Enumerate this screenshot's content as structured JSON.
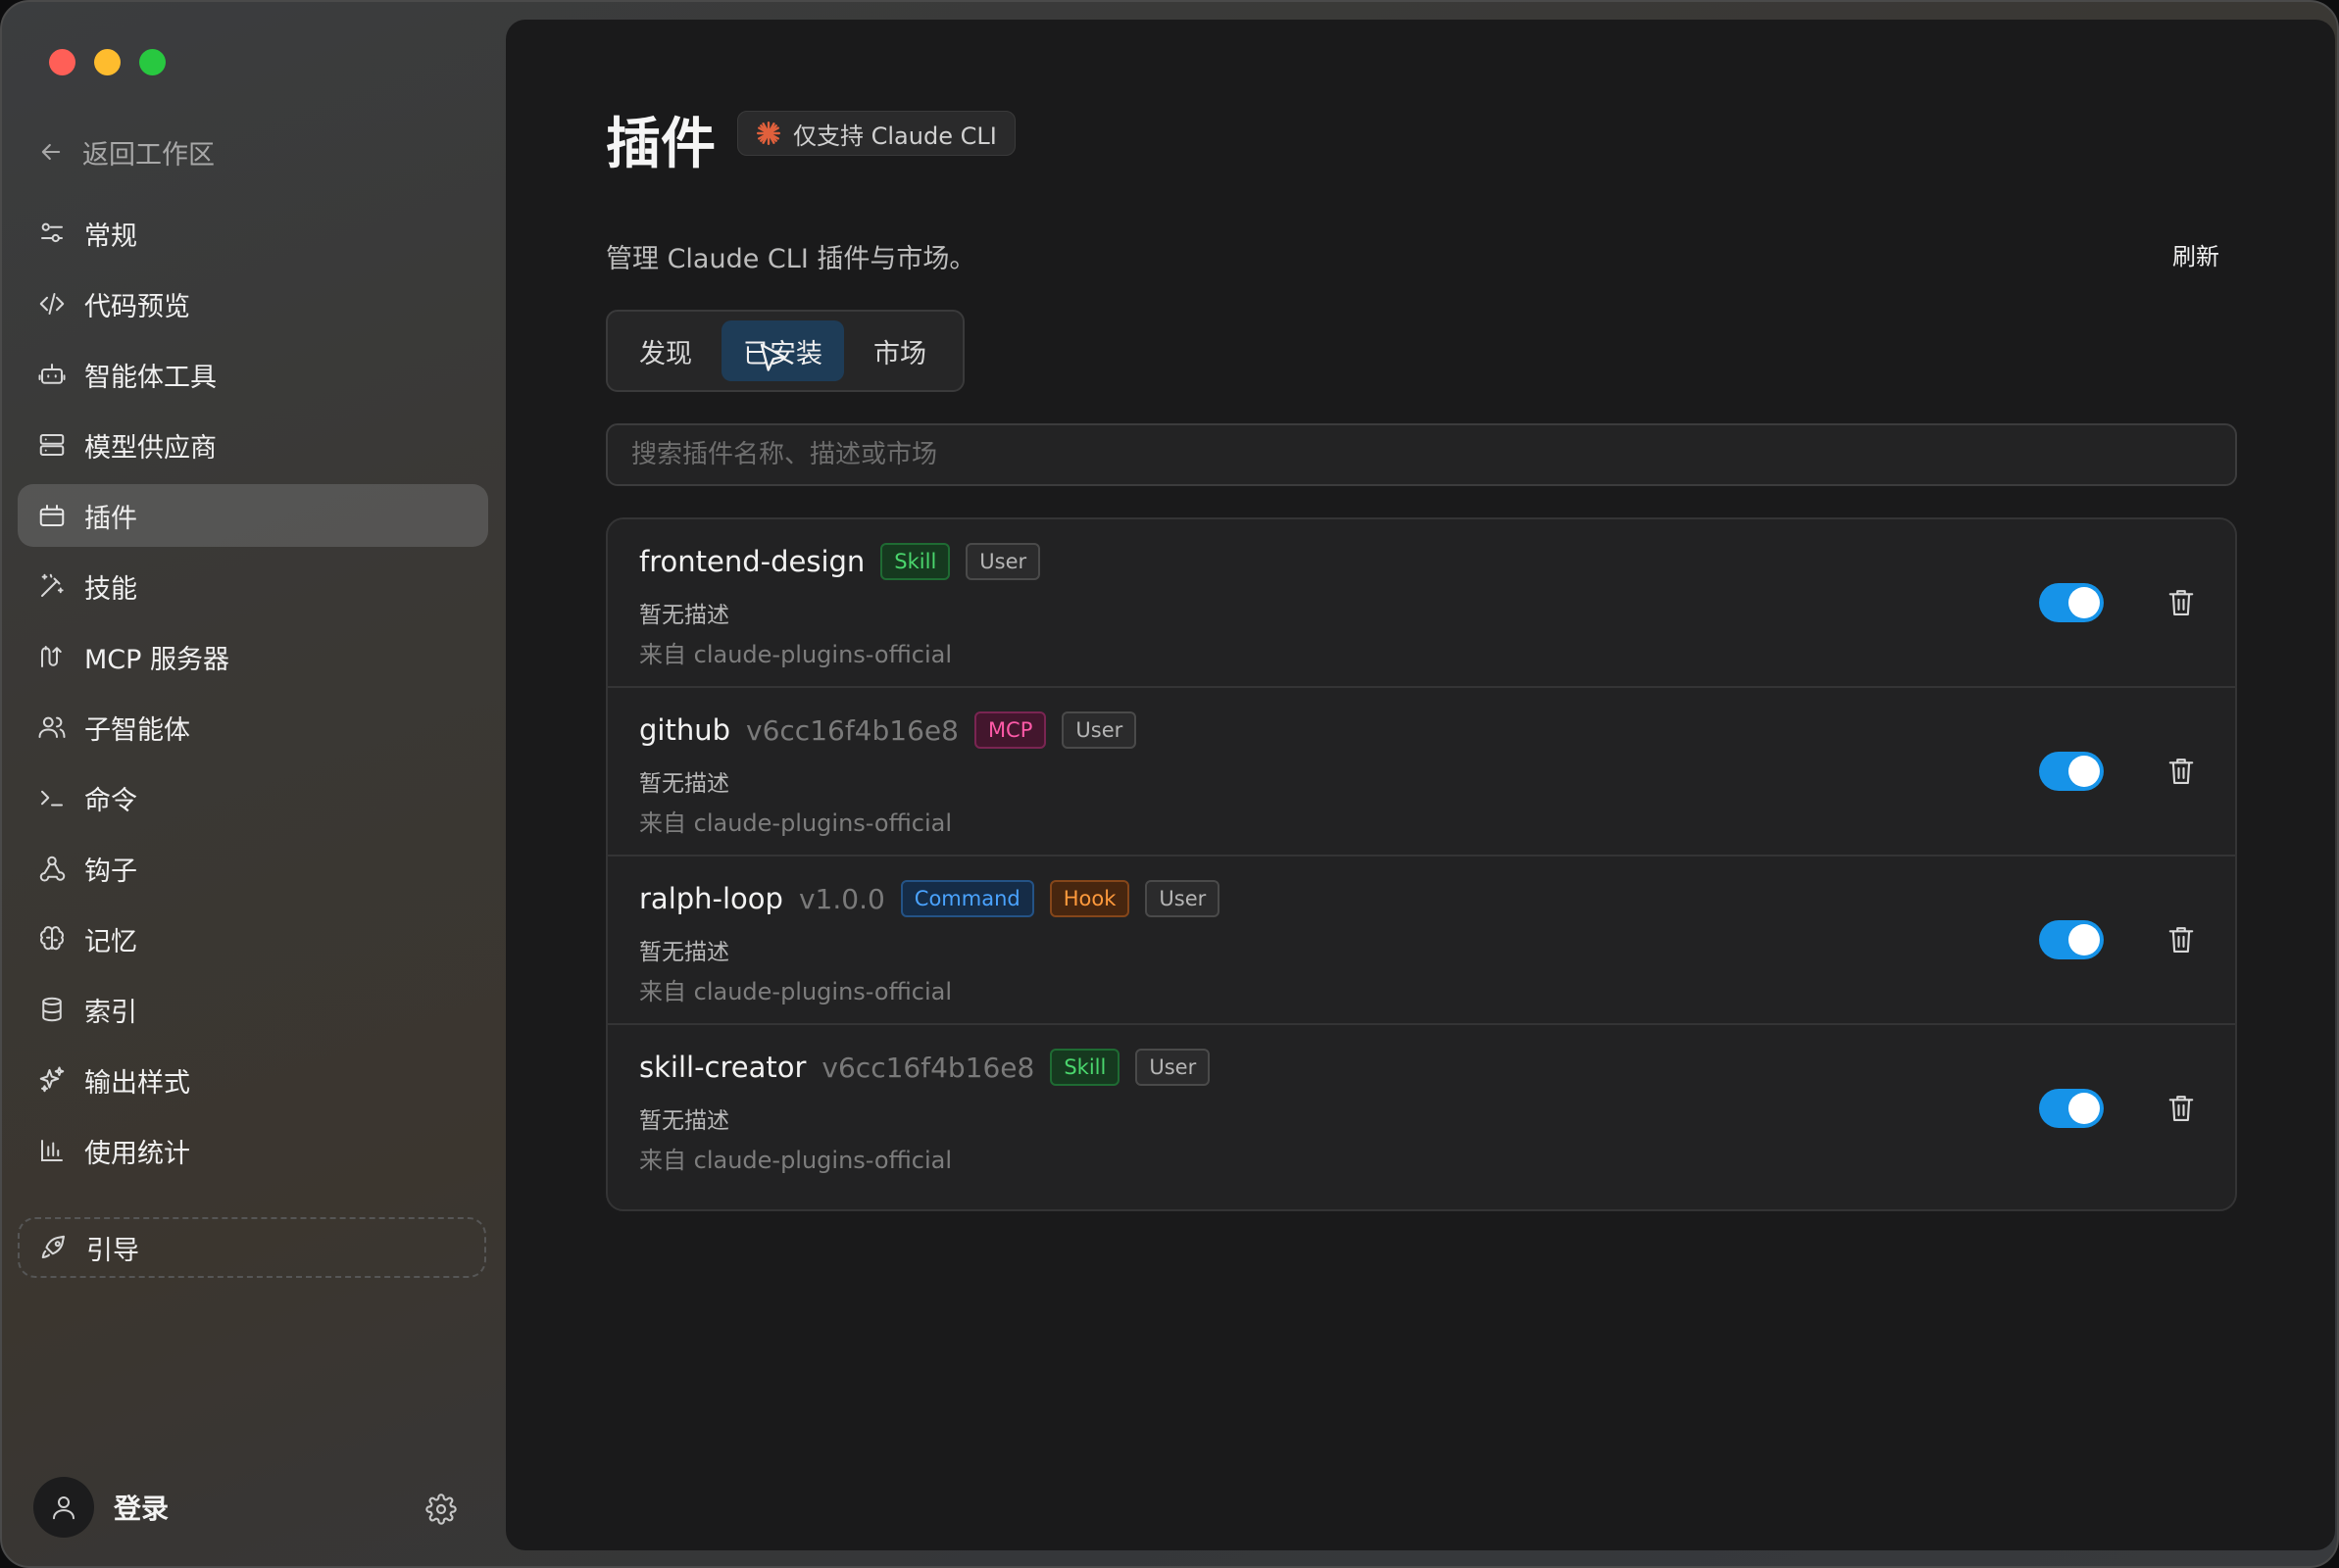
{
  "sidebar": {
    "back_label": "返回工作区",
    "items": [
      {
        "label": "常规",
        "icon": "sliders-icon"
      },
      {
        "label": "代码预览",
        "icon": "code-icon"
      },
      {
        "label": "智能体工具",
        "icon": "robot-icon"
      },
      {
        "label": "模型供应商",
        "icon": "server-icon"
      },
      {
        "label": "插件",
        "icon": "plugin-icon",
        "active": true
      },
      {
        "label": "技能",
        "icon": "magic-wand-icon"
      },
      {
        "label": "MCP 服务器",
        "icon": "mcp-icon"
      },
      {
        "label": "子智能体",
        "icon": "users-icon"
      },
      {
        "label": "命令",
        "icon": "terminal-icon"
      },
      {
        "label": "钩子",
        "icon": "webhook-icon"
      },
      {
        "label": "记忆",
        "icon": "brain-icon"
      },
      {
        "label": "索引",
        "icon": "database-icon"
      },
      {
        "label": "输出样式",
        "icon": "sparkles-icon"
      },
      {
        "label": "使用统计",
        "icon": "bar-chart-icon"
      }
    ],
    "guide_label": "引导",
    "account_label": "登录"
  },
  "main": {
    "title": "插件",
    "cli_badge": "仅支持 Claude CLI",
    "subtitle": "管理 Claude CLI 插件与市场。",
    "refresh_label": "刷新",
    "tabs": [
      {
        "label": "发现"
      },
      {
        "label": "已安装",
        "active": true
      },
      {
        "label": "市场"
      }
    ],
    "search_placeholder": "搜索插件名称、描述或市场",
    "plugins": [
      {
        "name": "frontend-design",
        "version": "",
        "tags": [
          {
            "label": "Skill",
            "kind": "skill"
          },
          {
            "label": "User",
            "kind": "user"
          }
        ],
        "description": "暂无描述",
        "source": "来自 claude-plugins-official",
        "enabled": true
      },
      {
        "name": "github",
        "version": "v6cc16f4b16e8",
        "tags": [
          {
            "label": "MCP",
            "kind": "mcp"
          },
          {
            "label": "User",
            "kind": "user"
          }
        ],
        "description": "暂无描述",
        "source": "来自 claude-plugins-official",
        "enabled": true
      },
      {
        "name": "ralph-loop",
        "version": "v1.0.0",
        "tags": [
          {
            "label": "Command",
            "kind": "command"
          },
          {
            "label": "Hook",
            "kind": "hook"
          },
          {
            "label": "User",
            "kind": "user"
          }
        ],
        "description": "暂无描述",
        "source": "来自 claude-plugins-official",
        "enabled": true
      },
      {
        "name": "skill-creator",
        "version": "v6cc16f4b16e8",
        "tags": [
          {
            "label": "Skill",
            "kind": "skill"
          },
          {
            "label": "User",
            "kind": "user"
          }
        ],
        "description": "暂无描述",
        "source": "来自 claude-plugins-official",
        "enabled": true
      }
    ]
  },
  "colors": {
    "accent": "#1693e8",
    "active_tab": "#1e3c57",
    "skill_tag": "#4ad66d",
    "mcp_tag": "#ff5aa8",
    "command_tag": "#4aa3ff",
    "hook_tag": "#ff9a3c"
  }
}
